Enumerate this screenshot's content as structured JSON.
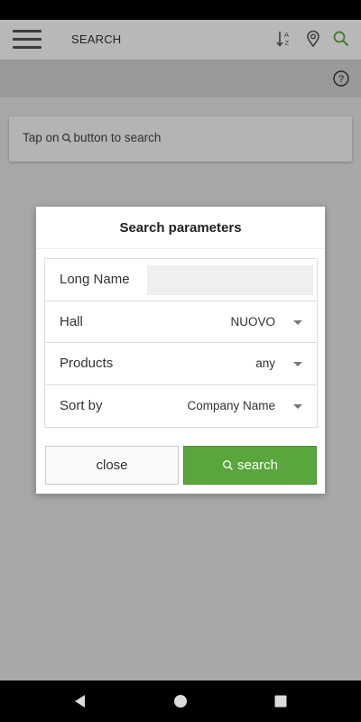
{
  "topbar": {
    "title": "SEARCH",
    "accent_color": "#5aa53c",
    "icons": [
      "menu-icon",
      "sort-alpha-icon",
      "location-pin-icon",
      "search-icon"
    ]
  },
  "subbar": {
    "icon": "help-icon"
  },
  "hint": {
    "prefix": "Tap on",
    "suffix": "button to search"
  },
  "dialog": {
    "title": "Search parameters",
    "fields": {
      "long_name": {
        "label": "Long Name",
        "value": ""
      },
      "hall": {
        "label": "Hall",
        "value": "NUOVO"
      },
      "products": {
        "label": "Products",
        "value": "any"
      },
      "sort_by": {
        "label": "Sort by",
        "value": "Company Name"
      }
    },
    "close_label": "close",
    "search_label": "search"
  },
  "navbar": {
    "icons": [
      "back-icon",
      "home-icon",
      "recents-icon"
    ]
  }
}
